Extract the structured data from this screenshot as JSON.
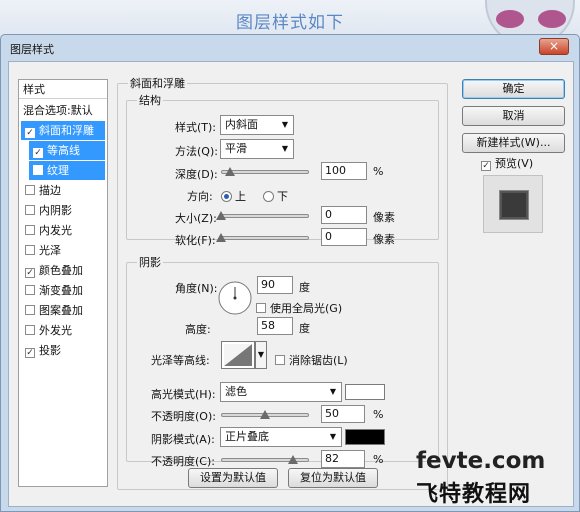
{
  "caption": "图层样式如下",
  "window": {
    "title": "图层样式",
    "close_glyph": "×"
  },
  "sidebar": {
    "header": "样式",
    "items": [
      {
        "label": "混合选项:默认",
        "checkbox": false,
        "checked": false,
        "selected": false,
        "sub": false
      },
      {
        "label": "斜面和浮雕",
        "checkbox": true,
        "checked": true,
        "selected": true,
        "sub": false
      },
      {
        "label": "等高线",
        "checkbox": true,
        "checked": true,
        "selected": true,
        "sub": true
      },
      {
        "label": "纹理",
        "checkbox": true,
        "checked": false,
        "selected": true,
        "sub": true
      },
      {
        "label": "描边",
        "checkbox": true,
        "checked": false,
        "selected": false,
        "sub": false
      },
      {
        "label": "内阴影",
        "checkbox": true,
        "checked": false,
        "selected": false,
        "sub": false
      },
      {
        "label": "内发光",
        "checkbox": true,
        "checked": false,
        "selected": false,
        "sub": false
      },
      {
        "label": "光泽",
        "checkbox": true,
        "checked": false,
        "selected": false,
        "sub": false
      },
      {
        "label": "颜色叠加",
        "checkbox": true,
        "checked": true,
        "selected": false,
        "sub": false
      },
      {
        "label": "渐变叠加",
        "checkbox": true,
        "checked": false,
        "selected": false,
        "sub": false
      },
      {
        "label": "图案叠加",
        "checkbox": true,
        "checked": false,
        "selected": false,
        "sub": false
      },
      {
        "label": "外发光",
        "checkbox": true,
        "checked": false,
        "selected": false,
        "sub": false
      },
      {
        "label": "投影",
        "checkbox": true,
        "checked": true,
        "selected": false,
        "sub": false
      }
    ]
  },
  "bevel": {
    "title": "斜面和浮雕",
    "structure": {
      "title": "结构",
      "style_label": "样式(T):",
      "style_value": "内斜面",
      "technique_label": "方法(Q):",
      "technique_value": "平滑",
      "depth_label": "深度(D):",
      "depth_value": "100",
      "depth_unit": "%",
      "depth_level": 0.1,
      "direction_label": "方向:",
      "direction_up": "上",
      "direction_down": "下",
      "size_label": "大小(Z):",
      "size_value": "0",
      "size_unit": "像素",
      "size_level": 0,
      "soften_label": "软化(F):",
      "soften_value": "0",
      "soften_unit": "像素",
      "soften_level": 0
    },
    "shading": {
      "title": "阴影",
      "angle_label": "角度(N):",
      "angle_value": "90",
      "angle_unit": "度",
      "global_light_label": "使用全局光(G)",
      "altitude_label": "高度:",
      "altitude_value": "58",
      "altitude_unit": "度",
      "gloss_label": "光泽等高线:",
      "antialias_label": "消除锯齿(L)",
      "highlight_mode_label": "高光模式(H):",
      "highlight_mode_value": "滤色",
      "highlight_color": "#ffffff",
      "highlight_opacity_label": "不透明度(O):",
      "highlight_opacity_value": "50",
      "highlight_opacity_unit": "%",
      "highlight_opacity_level": 0.5,
      "shadow_mode_label": "阴影模式(A):",
      "shadow_mode_value": "正片叠底",
      "shadow_color": "#000000",
      "shadow_opacity_label": "不透明度(C):",
      "shadow_opacity_value": "82",
      "shadow_opacity_unit": "%",
      "shadow_opacity_level": 0.82
    },
    "make_default": "设置为默认值",
    "reset_default": "复位为默认值"
  },
  "buttons": {
    "ok": "确定",
    "cancel": "取消",
    "new_style": "新建样式(W)...",
    "preview_label": "预览(V)"
  },
  "preview_swatch_color": "#3a3a3a",
  "watermark": {
    "line1": "fevte.com",
    "line2": "飞特教程网"
  }
}
